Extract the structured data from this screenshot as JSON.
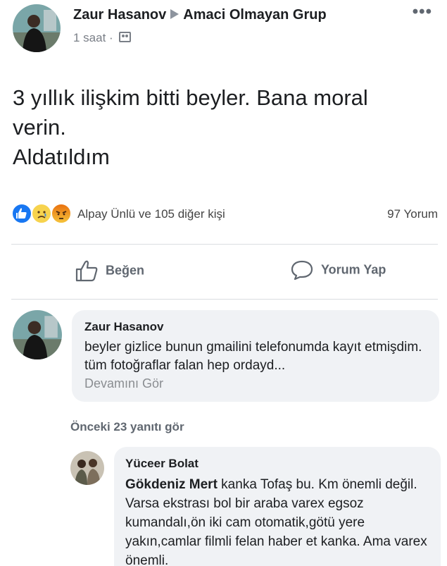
{
  "post": {
    "author": "Zaur Hasanov",
    "group": "Amaci Olmayan Grup",
    "time": "1 saat",
    "separator": "·",
    "more_icon": "more-horizontal-icon",
    "privacy_icon": "group-icon",
    "text_lines": [
      "3 yıllık ilişkim bitti beyler. Bana moral",
      "verin.",
      "Aldatıldım"
    ]
  },
  "reactions": {
    "icons": [
      "like-reaction-icon",
      "sad-reaction-icon",
      "angry-reaction-icon"
    ],
    "summary": "Alpay Ünlü ve 105 diğer kişi",
    "comments_count": "97 Yorum"
  },
  "actions": {
    "like_label": "Beğen",
    "comment_label": "Yorum Yap"
  },
  "comments": [
    {
      "author": "Zaur Hasanov",
      "text": "beyler gizlice bunun gmailini telefonumda kayıt etmişdim. tüm fotoğraflar falan hep ordayd...",
      "see_more": "Devamını Gör"
    }
  ],
  "previous_replies_label": "Önceki 23 yanıtı gör",
  "reply": {
    "author": "Yüceer Bolat",
    "mention": "Gökdeniz Mert",
    "text": " kanka Tofaş bu. Km önemli değil. Varsa ekstrası bol bir araba varex egsoz kumandalı,ön iki cam otomatik,götü yere yakın,camlar filmli felan haber et kanka. Ama varex önemli."
  },
  "colors": {
    "like_blue": "#1877f2",
    "bubble_bg": "#f0f2f5",
    "secondary_text": "#606770"
  }
}
